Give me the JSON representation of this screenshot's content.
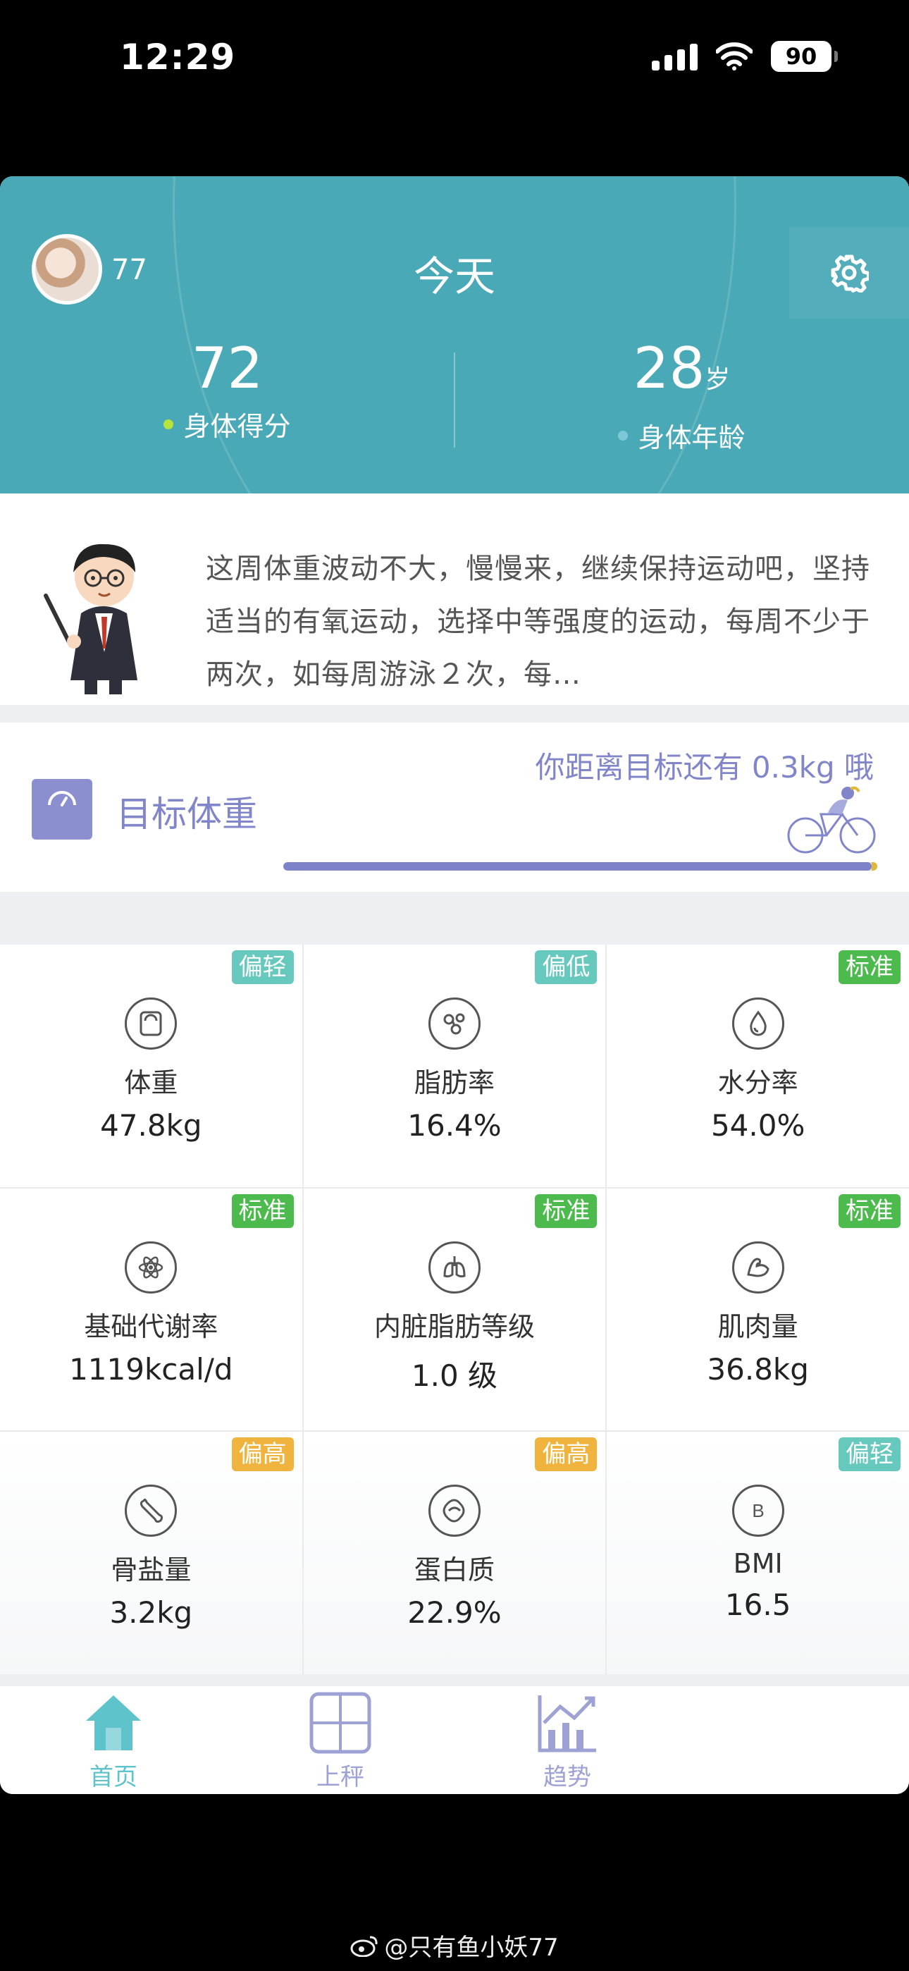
{
  "status_bar": {
    "time": "12:29",
    "battery": "90"
  },
  "header": {
    "username": "77",
    "title": "今天",
    "body_score": {
      "value": "72",
      "label": "身体得分"
    },
    "body_age": {
      "value": "28",
      "unit": "岁",
      "label": "身体年龄"
    },
    "colors": {
      "background": "#4aa9b7",
      "score_dot": "#b6e33c",
      "age_dot": "#7dc7d6"
    }
  },
  "advice": {
    "text": "这周体重波动不大，慢慢来，继续保持运动吧，坚持适当的有氧运动，选择中等强度的运动，每周不少于两次，如每周游泳２次，每…"
  },
  "goal": {
    "label": "目标体重",
    "message": "你距离目标还有 0.3kg 哦",
    "progress_percent": 99
  },
  "metrics": [
    {
      "name": "体重",
      "value": "47.8kg",
      "badge": "偏轻",
      "badge_color": "#67c9bd",
      "icon": "scale-icon"
    },
    {
      "name": "脂肪率",
      "value": "16.4%",
      "badge": "偏低",
      "badge_color": "#67c9bd",
      "icon": "molecule-icon"
    },
    {
      "name": "水分率",
      "value": "54.0%",
      "badge": "标准",
      "badge_color": "#4cba4c",
      "icon": "water-drop-icon"
    },
    {
      "name": "基础代谢率",
      "value": "1119kcal/d",
      "badge": "标准",
      "badge_color": "#4cba4c",
      "icon": "atom-icon"
    },
    {
      "name": "内脏脂肪等级",
      "value": "1.0 级",
      "badge": "标准",
      "badge_color": "#4cba4c",
      "icon": "lungs-icon"
    },
    {
      "name": "肌肉量",
      "value": "36.8kg",
      "badge": "标准",
      "badge_color": "#4cba4c",
      "icon": "muscle-arm-icon"
    },
    {
      "name": "骨盐量",
      "value": "3.2kg",
      "badge": "偏高",
      "badge_color": "#f0b43e",
      "icon": "bone-icon"
    },
    {
      "name": "蛋白质",
      "value": "22.9%",
      "badge": "偏高",
      "badge_color": "#f0b43e",
      "icon": "protein-icon"
    },
    {
      "name": "BMI",
      "value": "16.5",
      "badge": "偏轻",
      "badge_color": "#67c9bd",
      "icon": "bmi-icon"
    }
  ],
  "nav": {
    "items": [
      {
        "label": "首页",
        "icon": "home-icon",
        "active": true
      },
      {
        "label": "上秤",
        "icon": "scale-grid-icon",
        "active": false
      },
      {
        "label": "趋势",
        "icon": "trend-chart-icon",
        "active": false
      }
    ],
    "active_color": "#5fc3cc",
    "inactive_color": "#9ea1d4"
  },
  "watermark": {
    "text": "@只有鱼小妖77"
  }
}
